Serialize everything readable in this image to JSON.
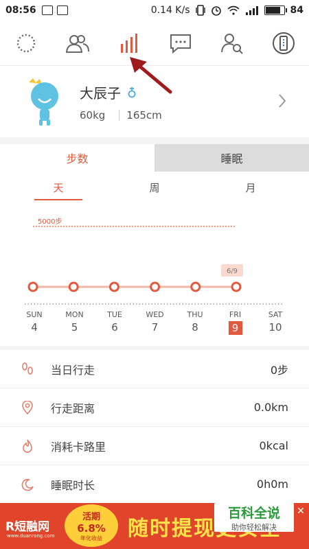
{
  "status_bar": {
    "time": "08:56",
    "net_speed": "0.14 K/s",
    "battery": "84",
    "battery_level": 0.84
  },
  "top_nav": {
    "icons": [
      "loading-ring-icon",
      "friends-icon",
      "stats-bars-icon",
      "message-icon",
      "find-user-icon",
      "phone-device-icon"
    ],
    "active_index": 2,
    "accent": "#e25a3d"
  },
  "profile": {
    "name": "大辰子",
    "weight": "60kg",
    "height": "165cm"
  },
  "metric_tabs": {
    "steps": "步数",
    "sleep": "睡眠"
  },
  "period_tabs": {
    "day": "天",
    "week": "周",
    "month": "月"
  },
  "chart": {
    "goal_label": "5000步",
    "tooltip": "6/9"
  },
  "chart_data": {
    "type": "line",
    "categories": [
      "SUN",
      "MON",
      "TUE",
      "WED",
      "THU",
      "FRI"
    ],
    "values": [
      0,
      0,
      0,
      0,
      0,
      0
    ],
    "goal": 5000,
    "selected": "FRI"
  },
  "days": [
    {
      "name": "SUN",
      "date": "4"
    },
    {
      "name": "MON",
      "date": "5"
    },
    {
      "name": "TUE",
      "date": "6"
    },
    {
      "name": "WED",
      "date": "7"
    },
    {
      "name": "THU",
      "date": "8"
    },
    {
      "name": "FRI",
      "date": "9"
    },
    {
      "name": "SAT",
      "date": "10"
    }
  ],
  "rows": [
    {
      "label": "当日行走",
      "value": "0步",
      "icon": "footprints-icon"
    },
    {
      "label": "行走距离",
      "value": "0.0km",
      "icon": "location-pin-icon"
    },
    {
      "label": "消耗卡路里",
      "value": "0kcal",
      "icon": "flame-icon"
    },
    {
      "label": "睡眠时长",
      "value": "0h0m",
      "icon": "moon-icon"
    }
  ],
  "ad": {
    "brand": "R短融网",
    "brand_sub": "www.duanrong.com",
    "badge_top": "活期",
    "badge_rate": "6.8%",
    "badge_sub": "年化收益",
    "slogan": "随时提现更安全",
    "close": "✕"
  },
  "watermark": {
    "title": "百科全说",
    "subtitle": "助你轻松解决"
  }
}
